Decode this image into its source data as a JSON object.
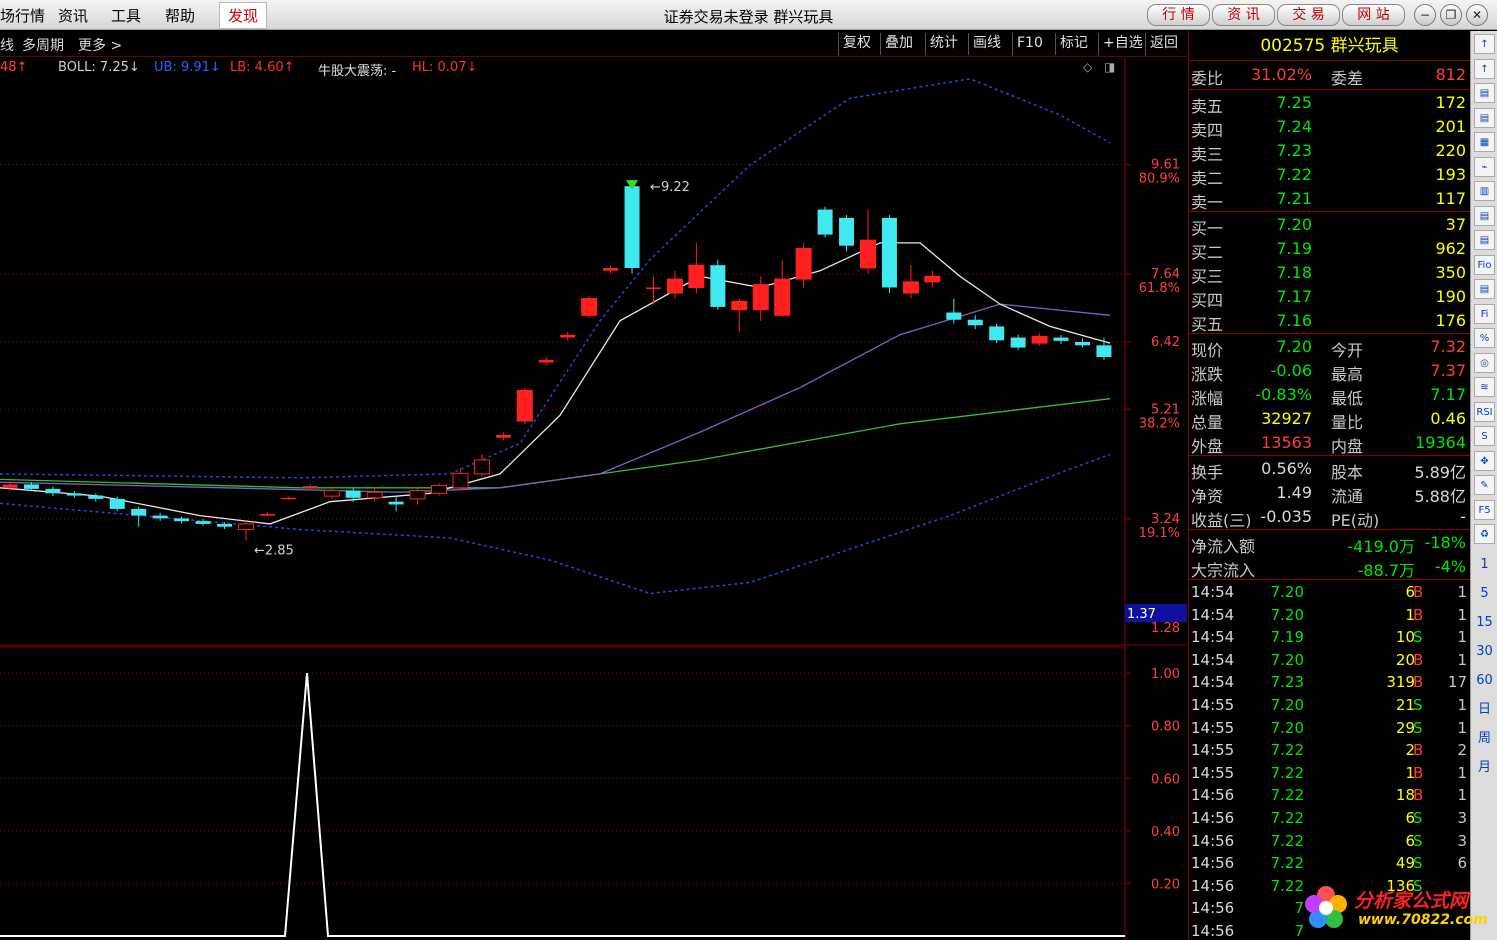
{
  "menu": {
    "items": [
      "场行情",
      "资讯",
      "工具",
      "帮助"
    ],
    "active": "发现",
    "title": "证券交易未登录  群兴玩具",
    "buttons": [
      "行 情",
      "资 讯",
      "交 易",
      "网 站"
    ],
    "window_controls": [
      "−",
      "❐",
      "✕"
    ]
  },
  "toolbar": {
    "left": [
      "线",
      "多周期",
      "更多 >"
    ],
    "right": [
      "复权",
      "叠加",
      "统计",
      "画线",
      "F10",
      "标记",
      "+自选",
      "返回"
    ]
  },
  "legend": {
    "first": "48↑",
    "boll": "BOLL: 7.25↓",
    "ub": "UB: 9.91↓",
    "lb": "LB: 4.60↑",
    "niugu": "牛股大震荡: -",
    "hl": "HL: 0.07↓"
  },
  "axis": {
    "price_labels": [
      "9.61",
      "7.64",
      "6.42",
      "5.21",
      "3.24",
      "1.28"
    ],
    "pct_labels": [
      "80.9%",
      "61.8%",
      "38.2%",
      "19.1%"
    ],
    "current_marker": "1.37",
    "sub_labels": [
      "1.00",
      "0.80",
      "0.60",
      "0.40",
      "0.20"
    ]
  },
  "annotations": {
    "high": "9.22",
    "low": "2.85"
  },
  "stock": {
    "code": "002575",
    "name": "群兴玩具"
  },
  "weibi": {
    "label": "委比",
    "value": "31.02%",
    "label2": "委差",
    "value2": "812"
  },
  "sells": [
    {
      "label": "卖五",
      "price": "7.25",
      "vol": "172"
    },
    {
      "label": "卖四",
      "price": "7.24",
      "vol": "201"
    },
    {
      "label": "卖三",
      "price": "7.23",
      "vol": "220"
    },
    {
      "label": "卖二",
      "price": "7.22",
      "vol": "193"
    },
    {
      "label": "卖一",
      "price": "7.21",
      "vol": "117"
    }
  ],
  "buys": [
    {
      "label": "买一",
      "price": "7.20",
      "vol": "37"
    },
    {
      "label": "买二",
      "price": "7.19",
      "vol": "962"
    },
    {
      "label": "买三",
      "price": "7.18",
      "vol": "350"
    },
    {
      "label": "买四",
      "price": "7.17",
      "vol": "190"
    },
    {
      "label": "买五",
      "price": "7.16",
      "vol": "176"
    }
  ],
  "quote": [
    {
      "l1": "现价",
      "v1": "7.20",
      "c1": "green",
      "l2": "今开",
      "v2": "7.32",
      "c2": "red"
    },
    {
      "l1": "涨跌",
      "v1": "-0.06",
      "c1": "green",
      "l2": "最高",
      "v2": "7.37",
      "c2": "red"
    },
    {
      "l1": "涨幅",
      "v1": "-0.83%",
      "c1": "green",
      "l2": "最低",
      "v2": "7.17",
      "c2": "green"
    },
    {
      "l1": "总量",
      "v1": "32927",
      "c1": "yellow",
      "l2": "量比",
      "v2": "0.46",
      "c2": "yellow"
    },
    {
      "l1": "外盘",
      "v1": "13563",
      "c1": "red",
      "l2": "内盘",
      "v2": "19364",
      "c2": "green"
    }
  ],
  "fundamentals": [
    {
      "l1": "换手",
      "v1": "0.56%",
      "l2": "股本",
      "v2": "5.89亿"
    },
    {
      "l1": "净资",
      "v1": "1.49",
      "l2": "流通",
      "v2": "5.88亿"
    },
    {
      "l1": "收益(三)",
      "v1": "-0.035",
      "l2": "PE(动)",
      "v2": "-"
    }
  ],
  "flow": [
    {
      "label": "净流入额",
      "value": "-419.0万",
      "pct": "-18%"
    },
    {
      "label": "大宗流入",
      "value": "-88.7万",
      "pct": "-4%"
    }
  ],
  "ticks": [
    {
      "time": "14:54",
      "price": "7.20",
      "pc": "green",
      "vol": "6",
      "bs": "B",
      "n": "1"
    },
    {
      "time": "14:54",
      "price": "7.20",
      "pc": "green",
      "vol": "1",
      "bs": "B",
      "n": "1"
    },
    {
      "time": "14:54",
      "price": "7.19",
      "pc": "green",
      "vol": "10",
      "bs": "S",
      "n": "1"
    },
    {
      "time": "14:54",
      "price": "7.20",
      "pc": "green",
      "vol": "20",
      "bs": "B",
      "n": "1"
    },
    {
      "time": "14:54",
      "price": "7.23",
      "pc": "green",
      "vol": "319",
      "bs": "B",
      "n": "17"
    },
    {
      "time": "14:55",
      "price": "7.20",
      "pc": "green",
      "vol": "21",
      "bs": "S",
      "n": "1"
    },
    {
      "time": "14:55",
      "price": "7.20",
      "pc": "green",
      "vol": "29",
      "bs": "S",
      "n": "1"
    },
    {
      "time": "14:55",
      "price": "7.22",
      "pc": "green",
      "vol": "2",
      "bs": "B",
      "n": "2"
    },
    {
      "time": "14:55",
      "price": "7.22",
      "pc": "green",
      "vol": "1",
      "bs": "B",
      "n": "1"
    },
    {
      "time": "14:56",
      "price": "7.22",
      "pc": "green",
      "vol": "18",
      "bs": "B",
      "n": "1"
    },
    {
      "time": "14:56",
      "price": "7.22",
      "pc": "green",
      "vol": "6",
      "bs": "S",
      "n": "3"
    },
    {
      "time": "14:56",
      "price": "7.22",
      "pc": "green",
      "vol": "6",
      "bs": "S",
      "n": "3"
    },
    {
      "time": "14:56",
      "price": "7.22",
      "pc": "green",
      "vol": "49",
      "bs": "S",
      "n": "6"
    },
    {
      "time": "14:56",
      "price": "7.22",
      "pc": "green",
      "vol": "136",
      "bs": "S",
      "n": ""
    },
    {
      "time": "14:56",
      "price": "7",
      "pc": "green",
      "vol": "",
      "bs": "",
      "n": ""
    },
    {
      "time": "14:56",
      "price": "7",
      "pc": "green",
      "vol": "",
      "bs": "",
      "n": ""
    }
  ],
  "icons": [
    "↑",
    "↑",
    "▤",
    "▤",
    "▦",
    "⌁",
    "▥",
    "▤",
    "▤",
    "Fio",
    "▤",
    "Fi",
    "%",
    "◎",
    "≋",
    "RSI",
    "S",
    "✥",
    "✎",
    "F5",
    "♻"
  ],
  "periods": [
    "1",
    "5",
    "15",
    "30",
    "60",
    "日",
    "周",
    "月"
  ],
  "watermark": {
    "text": "分析家公式网",
    "url": "www.70822.com"
  },
  "chart_data": {
    "type": "candlestick",
    "price_range": [
      1.28,
      11.2
    ],
    "candles": [
      [
        3.8,
        3.86,
        3.75,
        3.9
      ],
      [
        3.86,
        3.78,
        3.74,
        3.9
      ],
      [
        3.78,
        3.7,
        3.65,
        3.82
      ],
      [
        3.7,
        3.66,
        3.62,
        3.74
      ],
      [
        3.66,
        3.6,
        3.55,
        3.7
      ],
      [
        3.6,
        3.42,
        3.38,
        3.64
      ],
      [
        3.42,
        3.3,
        3.1,
        3.46
      ],
      [
        3.3,
        3.25,
        3.2,
        3.35
      ],
      [
        3.25,
        3.2,
        3.16,
        3.28
      ],
      [
        3.2,
        3.15,
        3.12,
        3.24
      ],
      [
        3.15,
        3.1,
        3.06,
        3.18
      ],
      [
        3.05,
        3.15,
        2.85,
        3.2
      ],
      [
        3.3,
        3.33,
        3.28,
        3.36
      ],
      [
        3.6,
        3.62,
        3.58,
        3.64
      ],
      [
        3.8,
        3.83,
        3.78,
        3.86
      ],
      [
        3.65,
        3.75,
        3.6,
        3.78
      ],
      [
        3.75,
        3.62,
        3.55,
        3.8
      ],
      [
        3.62,
        3.72,
        3.55,
        3.8
      ],
      [
        3.55,
        3.5,
        3.38,
        3.66
      ],
      [
        3.6,
        3.75,
        3.5,
        3.8
      ],
      [
        3.7,
        3.84,
        3.66,
        3.88
      ],
      [
        3.8,
        4.06,
        3.75,
        4.15
      ],
      [
        4.05,
        4.3,
        4.0,
        4.4
      ],
      [
        4.7,
        4.75,
        4.65,
        4.8
      ],
      [
        5.0,
        5.55,
        4.95,
        5.6
      ],
      [
        6.05,
        6.1,
        6.0,
        6.15
      ],
      [
        6.5,
        6.55,
        6.45,
        6.6
      ],
      [
        6.9,
        7.2,
        6.85,
        7.25
      ],
      [
        7.7,
        7.75,
        7.65,
        7.8
      ],
      [
        9.22,
        7.75,
        7.65,
        9.22
      ],
      [
        7.4,
        7.4,
        7.1,
        7.6
      ],
      [
        7.3,
        7.55,
        7.2,
        7.7
      ],
      [
        7.4,
        7.8,
        7.3,
        8.2
      ],
      [
        7.8,
        7.05,
        7.0,
        7.9
      ],
      [
        7.0,
        7.15,
        6.6,
        7.2
      ],
      [
        7.0,
        7.45,
        6.8,
        7.6
      ],
      [
        6.9,
        7.55,
        6.9,
        7.9
      ],
      [
        7.55,
        8.1,
        7.4,
        8.2
      ],
      [
        8.8,
        8.35,
        8.3,
        8.85
      ],
      [
        8.65,
        8.15,
        8.05,
        8.7
      ],
      [
        7.75,
        8.25,
        7.65,
        8.8
      ],
      [
        8.65,
        7.4,
        7.3,
        8.7
      ],
      [
        7.3,
        7.5,
        7.2,
        7.8
      ],
      [
        7.5,
        7.6,
        7.4,
        7.7
      ],
      [
        6.95,
        6.82,
        6.75,
        7.2
      ],
      [
        6.82,
        6.72,
        6.65,
        6.9
      ],
      [
        6.7,
        6.45,
        6.4,
        6.75
      ],
      [
        6.5,
        6.32,
        6.28,
        6.55
      ],
      [
        6.4,
        6.52,
        6.35,
        6.58
      ],
      [
        6.5,
        6.44,
        6.38,
        6.55
      ],
      [
        6.42,
        6.36,
        6.32,
        6.48
      ],
      [
        6.36,
        6.15,
        6.1,
        6.5
      ]
    ],
    "mid_band": [
      [
        0,
        3.9
      ],
      [
        400,
        3.72
      ],
      [
        500,
        3.8
      ],
      [
        600,
        4.05
      ],
      [
        700,
        4.8
      ],
      [
        800,
        5.6
      ],
      [
        900,
        6.55
      ],
      [
        1000,
        7.1
      ],
      [
        1110,
        6.9
      ]
    ],
    "upper_band": [
      [
        0,
        4.05
      ],
      [
        300,
        3.98
      ],
      [
        450,
        4.05
      ],
      [
        520,
        4.6
      ],
      [
        600,
        6.8
      ],
      [
        650,
        7.9
      ],
      [
        750,
        9.6
      ],
      [
        850,
        10.8
      ],
      [
        970,
        11.15
      ],
      [
        1060,
        10.5
      ],
      [
        1110,
        10.0
      ]
    ],
    "lower_band": [
      [
        0,
        3.52
      ],
      [
        300,
        3.05
      ],
      [
        450,
        2.9
      ],
      [
        550,
        2.5
      ],
      [
        650,
        1.9
      ],
      [
        750,
        2.1
      ],
      [
        850,
        2.7
      ],
      [
        950,
        3.3
      ],
      [
        1050,
        4.0
      ],
      [
        1110,
        4.4
      ]
    ],
    "long_ma": [
      [
        0,
        3.95
      ],
      [
        300,
        3.8
      ],
      [
        500,
        3.8
      ],
      [
        700,
        4.3
      ],
      [
        900,
        4.95
      ],
      [
        1110,
        5.4
      ]
    ],
    "short_ma": [
      [
        0,
        3.8
      ],
      [
        100,
        3.65
      ],
      [
        200,
        3.3
      ],
      [
        270,
        3.15
      ],
      [
        330,
        3.55
      ],
      [
        430,
        3.7
      ],
      [
        500,
        4.05
      ],
      [
        560,
        5.1
      ],
      [
        620,
        6.8
      ],
      [
        700,
        7.6
      ],
      [
        760,
        7.4
      ],
      [
        820,
        7.7
      ],
      [
        880,
        8.2
      ],
      [
        920,
        8.2
      ],
      [
        960,
        7.6
      ],
      [
        1000,
        7.1
      ],
      [
        1050,
        6.7
      ],
      [
        1110,
        6.4
      ]
    ],
    "sub_indicator": [
      [
        0,
        0
      ],
      [
        285,
        0
      ],
      [
        307,
        1.0
      ],
      [
        328,
        0
      ],
      [
        1125,
        0
      ]
    ],
    "sub_range": [
      0,
      1.05
    ]
  },
  "colors": {
    "up": "#ff2020",
    "down": "#40e8f0",
    "mid": "#8060c0",
    "band": "#3040d0",
    "ma": "#30c030",
    "grid": "#8b0000"
  }
}
